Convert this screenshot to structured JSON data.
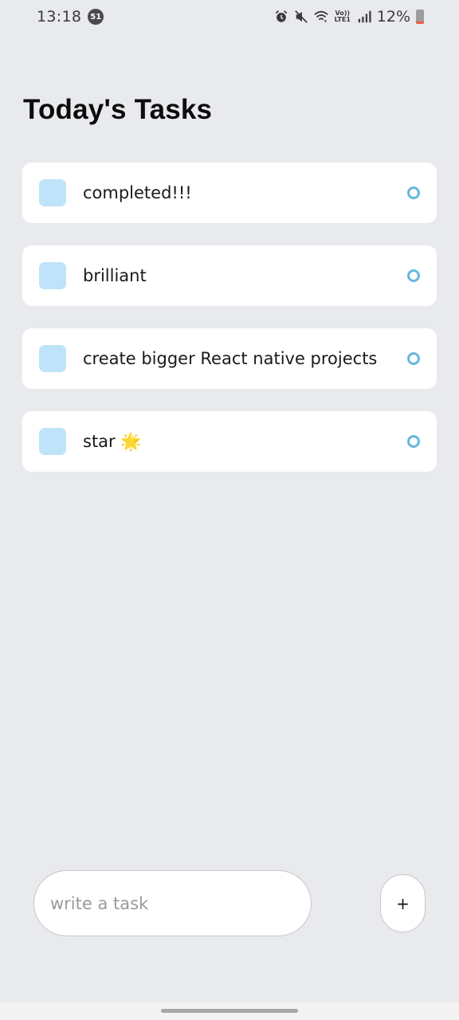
{
  "status_bar": {
    "time": "13:18",
    "notification_count": "51",
    "network": "Vo)) LTE1",
    "battery_percent": "12%",
    "battery_level": 0.12,
    "battery_low_color": "#e9623f"
  },
  "page_title": "Today's Tasks",
  "tasks": [
    {
      "text": "completed!!!"
    },
    {
      "text": "brilliant"
    },
    {
      "text": "create bigger React native projects"
    },
    {
      "text": "star 🌟"
    }
  ],
  "input": {
    "placeholder": "write a task",
    "value": ""
  },
  "add_button_label": "+",
  "colors": {
    "background": "#e8eaed",
    "card": "#ffffff",
    "task_square": "#bfe3f8",
    "task_circle": "#67b7df"
  }
}
